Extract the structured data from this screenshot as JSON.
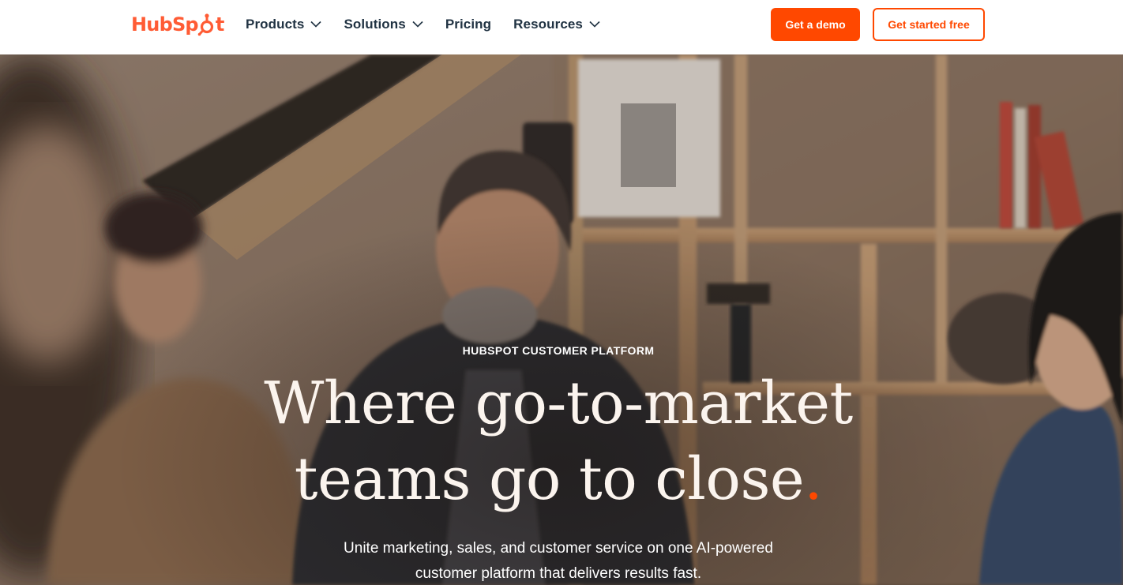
{
  "brand": {
    "name_pre": "HubSp",
    "name_post": "t",
    "accent": "#ff4800",
    "logo_color": "#ff5c35"
  },
  "nav": {
    "items": [
      {
        "label": "Products",
        "has_dropdown": true
      },
      {
        "label": "Solutions",
        "has_dropdown": true
      },
      {
        "label": "Pricing",
        "has_dropdown": false
      },
      {
        "label": "Resources",
        "has_dropdown": true
      }
    ]
  },
  "actions": {
    "demo_label": "Get a demo",
    "free_label": "Get started free"
  },
  "hero": {
    "eyebrow": "HUBSPOT CUSTOMER PLATFORM",
    "headline_line1": "Where go-to-market",
    "headline_line2": "teams go to close",
    "headline_dot": ".",
    "subtext_line1": "Unite marketing, sales, and customer service on one AI-powered",
    "subtext_line2": "customer platform that delivers results fast."
  },
  "icons": {
    "chevron": "chevron-down-icon",
    "logo": "hubspot-sprocket-icon"
  }
}
